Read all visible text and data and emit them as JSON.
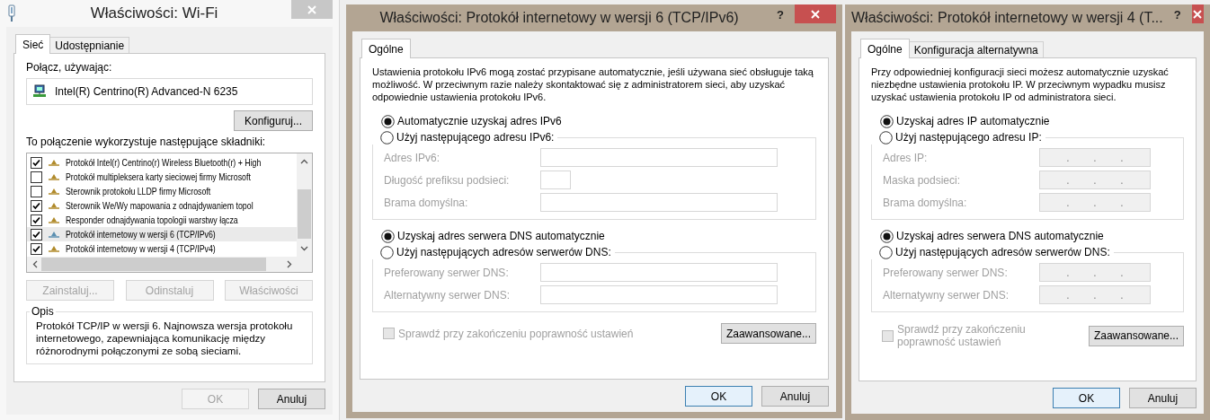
{
  "windows": [
    {
      "kind": "adapter",
      "title": "Właściwości: Wi-Fi",
      "active": false,
      "tabs": [
        {
          "label": "Sieć",
          "selected": true
        },
        {
          "label": "Udostępnianie",
          "selected": false
        }
      ],
      "connect_label": "Połącz, używając:",
      "adapter": "Intel(R) Centrino(R) Advanced-N 6235",
      "configure_button": "Konfiguruj...",
      "components_label": "To połączenie wykorzystuje następujące składniki:",
      "components": [
        {
          "label": "Protokół Intel(r) Centrino(r) Wireless Bluetooth(r) + High",
          "checked": true,
          "selected": false
        },
        {
          "label": "Protokół multipleksera karty sieciowej firmy Microsoft",
          "checked": false,
          "selected": false
        },
        {
          "label": "Sterownik protokołu LLDP firmy Microsoft",
          "checked": false,
          "selected": false
        },
        {
          "label": "Sterownik We/Wy mapowania z odnajdywaniem topol",
          "checked": true,
          "selected": false
        },
        {
          "label": "Responder odnajdywania topologii warstwy łącza",
          "checked": true,
          "selected": false
        },
        {
          "label": "Protokół internetowy w wersji 6 (TCP/IPv6)",
          "checked": true,
          "selected": true
        },
        {
          "label": "Protokół internetowy w wersji 4 (TCP/IPv4)",
          "checked": true,
          "selected": false
        }
      ],
      "component_buttons": [
        {
          "label": "Zainstaluj...",
          "disabled": true
        },
        {
          "label": "Odinstaluj",
          "disabled": true
        },
        {
          "label": "Właściwości",
          "disabled": true
        }
      ],
      "description": {
        "title": "Opis",
        "text": "Protokół TCP/IP w wersji 6. Najnowsza wersja protokołu internetowego, zapewniająca komunikację między różnorodnymi połączonymi ze sobą sieciami."
      },
      "buttons": [
        {
          "label": "OK",
          "disabled": true,
          "default": false
        },
        {
          "label": "Anuluj",
          "disabled": false,
          "default": false
        }
      ]
    },
    {
      "kind": "ip",
      "title": "Właściwości: Protokół internetowy w wersji 6 (TCP/IPv6)",
      "active": true,
      "help": "?",
      "tabs": [
        {
          "label": "Ogólne",
          "selected": true
        }
      ],
      "intro": "Ustawienia protokołu IPv6 mogą zostać przypisane automatycznie, jeśli używana sieć obsługuje taką możliwość. W przeciwnym razie należy skontaktować się z administratorem sieci, aby uzyskać odpowiednie ustawienia protokołu IPv6.",
      "address_options": [
        {
          "label": "Automatycznie uzyskaj adres IPv6",
          "selected": true
        },
        {
          "label": "Użyj następującego adresu IPv6:",
          "selected": false
        }
      ],
      "address_fields": [
        {
          "label": "Adres IPv6:",
          "kind": "text",
          "disabled": true
        },
        {
          "label": "Długość prefiksu podsieci:",
          "kind": "short",
          "disabled": true
        },
        {
          "label": "Brama domyślna:",
          "kind": "text",
          "disabled": true
        }
      ],
      "dns_options": [
        {
          "label": "Uzyskaj adres serwera DNS automatycznie",
          "selected": true
        },
        {
          "label": "Użyj następujących adresów serwerów DNS:",
          "selected": false
        }
      ],
      "dns_fields": [
        {
          "label": "Preferowany serwer DNS:",
          "kind": "text",
          "disabled": true
        },
        {
          "label": "Alternatywny serwer DNS:",
          "kind": "text",
          "disabled": true
        }
      ],
      "validate": {
        "label": "Sprawdź przy zakończeniu poprawność ustawień",
        "checked": false,
        "disabled": true
      },
      "advanced_button": "Zaawansowane...",
      "buttons": [
        {
          "label": "OK",
          "disabled": false,
          "default": true
        },
        {
          "label": "Anuluj",
          "disabled": false,
          "default": false
        }
      ]
    },
    {
      "kind": "ip",
      "title": "Właściwości: Protokół internetowy w wersji 4 (T...",
      "active": true,
      "help": "?",
      "tabs": [
        {
          "label": "Ogólne",
          "selected": true
        },
        {
          "label": "Konfiguracja alternatywna",
          "selected": false
        }
      ],
      "intro": "Przy odpowiedniej konfiguracji sieci możesz automatycznie uzyskać niezbędne ustawienia protokołu IP. W przeciwnym wypadku musisz uzyskać ustawienia protokołu IP od administratora sieci.",
      "address_options": [
        {
          "label": "Uzyskaj adres IP automatycznie",
          "selected": true
        },
        {
          "label": "Użyj następującego adresu IP:",
          "selected": false
        }
      ],
      "address_fields": [
        {
          "label": "Adres IP:",
          "kind": "ip",
          "disabled": true,
          "separators": [
            ".",
            ".",
            "."
          ]
        },
        {
          "label": "Maska podsieci:",
          "kind": "ip",
          "disabled": true,
          "separators": [
            ".",
            ".",
            "."
          ]
        },
        {
          "label": "Brama domyślna:",
          "kind": "ip",
          "disabled": true,
          "separators": [
            ".",
            ".",
            "."
          ]
        }
      ],
      "dns_options": [
        {
          "label": "Uzyskaj adres serwera DNS automatycznie",
          "selected": true
        },
        {
          "label": "Użyj następujących adresów serwerów DNS:",
          "selected": false
        }
      ],
      "dns_fields": [
        {
          "label": "Preferowany serwer DNS:",
          "kind": "ip",
          "disabled": true,
          "separators": [
            ".",
            ".",
            "."
          ]
        },
        {
          "label": "Alternatywny serwer DNS:",
          "kind": "ip",
          "disabled": true,
          "separators": [
            ".",
            ".",
            "."
          ]
        }
      ],
      "validate": {
        "label": "Sprawdź przy zakończeniu poprawność ustawień",
        "checked": false,
        "disabled": true
      },
      "advanced_button": "Zaawansowane...",
      "buttons": [
        {
          "label": "OK",
          "disabled": false,
          "default": true
        },
        {
          "label": "Anuluj",
          "disabled": false,
          "default": false
        }
      ]
    }
  ]
}
